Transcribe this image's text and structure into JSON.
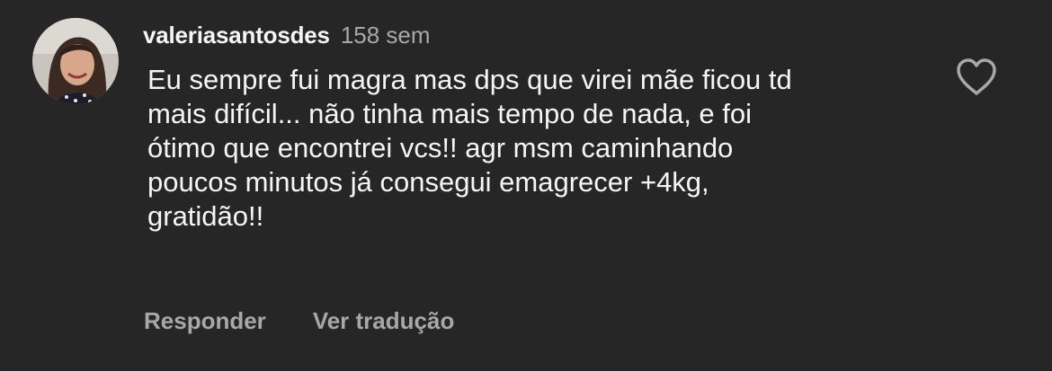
{
  "comment": {
    "username": "valeriasantosdes",
    "time": "158 sem",
    "text_lines": [
      "Eu sempre fui magra mas dps que virei mãe ficou td",
      "mais difícil... não tinha mais tempo de nada, e foi",
      "ótimo que encontrei vcs!! agr msm caminhando",
      "poucos minutos já consegui emagrecer +4kg,",
      "gratidão!!"
    ],
    "like_icon": "heart-outline-icon"
  },
  "actions": {
    "reply_label": "Responder",
    "translate_label": "Ver tradução"
  },
  "colors": {
    "background": "#262626",
    "primary_text": "#f5f5f5",
    "secondary_text": "#a8a8a8"
  }
}
